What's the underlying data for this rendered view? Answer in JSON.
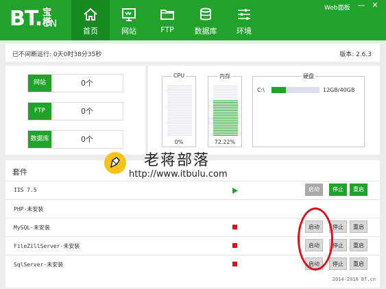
{
  "brand": {
    "logo": "BT.",
    "cn_top": "宝塔",
    "cn_bottom": "CN"
  },
  "nav": [
    {
      "label": "首页",
      "icon": "home-icon",
      "active": true
    },
    {
      "label": "网站",
      "icon": "monitor-icon",
      "active": false
    },
    {
      "label": "FTP",
      "icon": "folder-icon",
      "active": false
    },
    {
      "label": "数据库",
      "icon": "database-icon",
      "active": false
    },
    {
      "label": "环境",
      "icon": "sliders-icon",
      "active": false
    }
  ],
  "window": {
    "web_panel": "Web面板",
    "minimize": "—",
    "close": "✕"
  },
  "status": {
    "uptime": "已不间断运行: 0天0时38分35秒",
    "version": "版本: 2.6.3"
  },
  "stats": [
    {
      "label": "网站",
      "value": "0个"
    },
    {
      "label": "FTP",
      "value": "0个"
    },
    {
      "label": "数据库",
      "value": "0个"
    }
  ],
  "monitor": {
    "cpu": {
      "title": "CPU",
      "percent": 0,
      "label": "0%"
    },
    "mem": {
      "title": "内存",
      "percent": 72.22,
      "label": "72.22%"
    },
    "disk": {
      "title": "硬盘",
      "drive": "C:\\",
      "used_fraction": 0.3,
      "size": "12GB/40GB"
    }
  },
  "plugins": {
    "title": "套件",
    "rows": [
      {
        "name": "IIS 7.5",
        "indicator": "running",
        "buttons": {
          "start": "启动",
          "stop": "停止",
          "restart": "重启"
        }
      },
      {
        "name": "PHP-未安装",
        "indicator": "none",
        "buttons": null
      },
      {
        "name": "MySQL-未安装",
        "indicator": "stopped",
        "buttons": {
          "start": "启动",
          "stop": "停止",
          "restart": "重启"
        }
      },
      {
        "name": "FileZillServer-未安装",
        "indicator": "stopped",
        "buttons": {
          "start": "启动",
          "stop": "停止",
          "restart": "重启"
        }
      },
      {
        "name": "SqlServer-未安装",
        "indicator": "stopped",
        "buttons": {
          "start": "启动",
          "stop": "停止",
          "restart": "重启"
        }
      }
    ],
    "copyright": "2014-2016 BT.cn"
  },
  "watermark": {
    "cn": "老蒋部落",
    "url": "http://www.itbulu.com"
  },
  "colors": {
    "green": "#21a32b",
    "dark_green": "#178a21",
    "red": "#e0101a"
  }
}
